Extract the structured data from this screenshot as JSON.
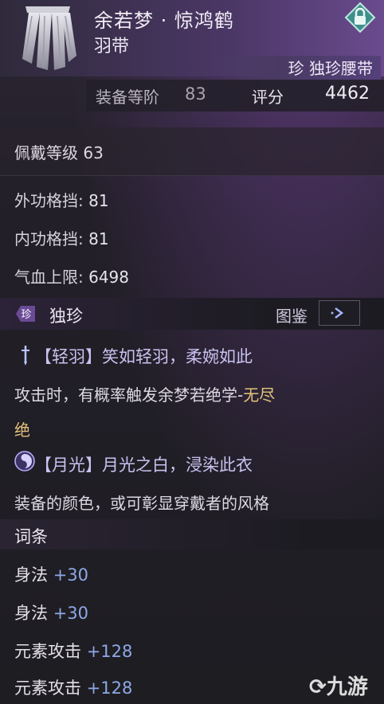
{
  "item": {
    "name": "余若梦 · 惊鸿鹤",
    "type": "羽带",
    "rarity_label": "珍 独珍腰带",
    "equip_rank_label": "装备等阶",
    "equip_rank_value": "83",
    "score_label": "评分",
    "score_value": "4462",
    "wear_level": "佩戴等级 63"
  },
  "base_stats": [
    {
      "label": "外功格挡:",
      "value": "81"
    },
    {
      "label": "内功格挡:",
      "value": "81"
    },
    {
      "label": "气血上限:",
      "value": "6498"
    }
  ],
  "unique": {
    "badge": "珍",
    "title": "独珍",
    "atlas_label": "图鉴",
    "skill1_name": "【轻羽】笑如轻羽，柔婉如此",
    "skill1_desc_a": "攻击时，有概率触发余梦若绝学-",
    "skill1_desc_gold": "无尽",
    "skill1_desc_b": "绝",
    "skill2_name": "【月光】月光之白，浸染此衣",
    "skill2_desc": "装备的颜色，或可彰显穿戴者的风格"
  },
  "affix": {
    "title": "词条",
    "items": [
      {
        "label": "身法",
        "value": "+30"
      },
      {
        "label": "身法",
        "value": "+30"
      },
      {
        "label": "元素攻击",
        "value": "+128"
      },
      {
        "label": "元素攻击",
        "value": "+128"
      }
    ]
  },
  "watermark": "九游",
  "colors": {
    "accent_gold": "#e3c27a",
    "affix_blue": "#8ea8e6",
    "skill_lavender": "#c9c2f0"
  }
}
